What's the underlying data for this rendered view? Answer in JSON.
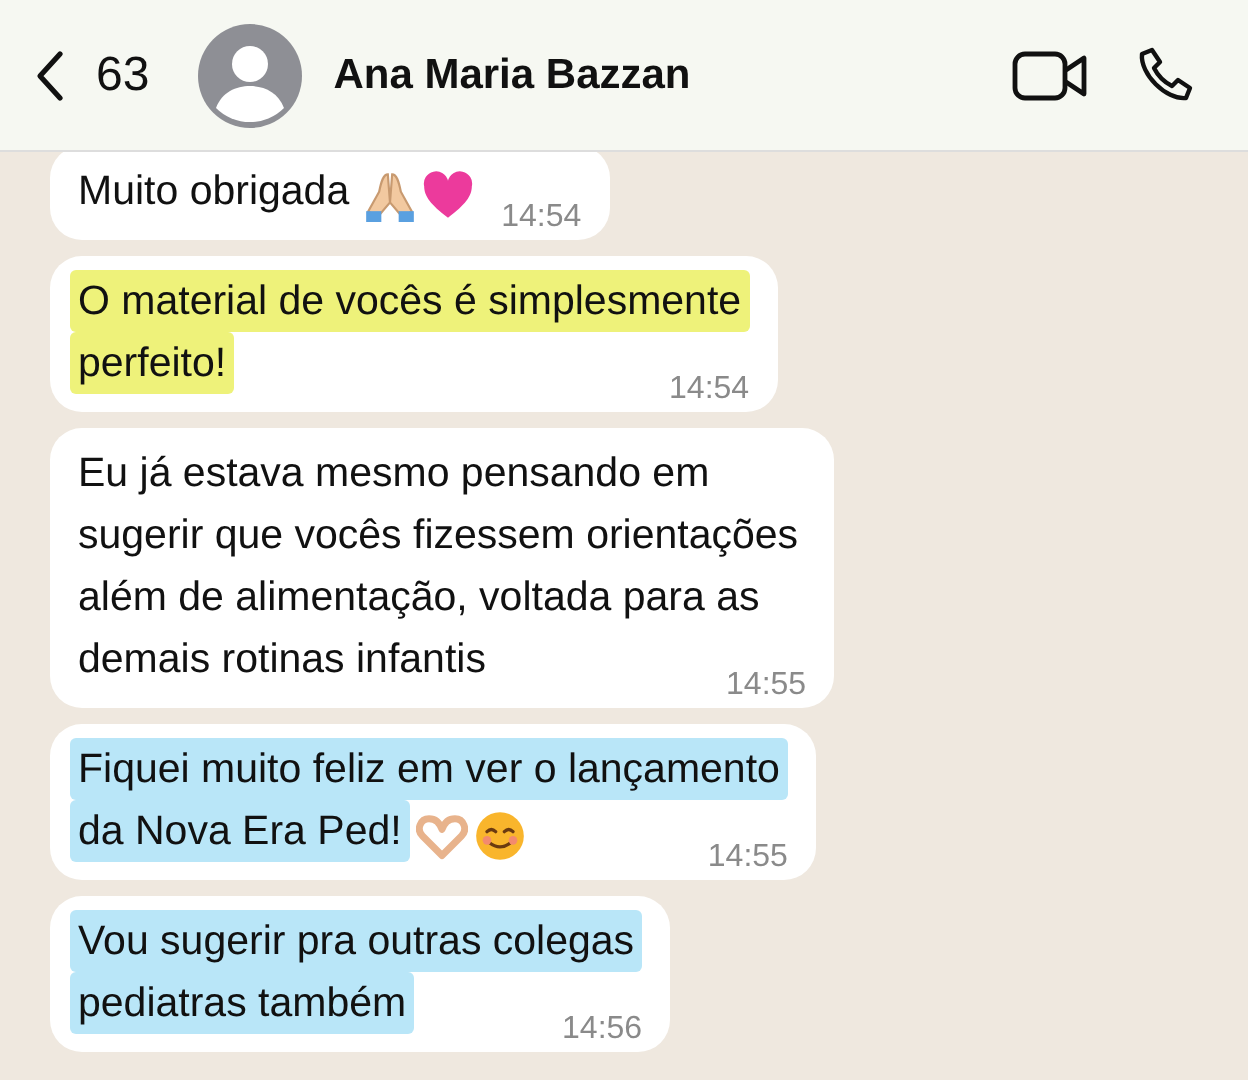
{
  "header": {
    "back_count": "63",
    "contact_name": "Ana Maria Bazzan"
  },
  "messages": [
    {
      "lines": [
        "Muito obrigada"
      ],
      "icons": [
        {
          "kind": "praying-hands"
        },
        {
          "kind": "heart"
        }
      ],
      "time": "14:54"
    },
    {
      "lines": [
        "O material de vocês é simplesmente",
        "perfeito!"
      ],
      "color": "#eef27a",
      "time": "14:54"
    },
    {
      "lines": [
        "Eu já estava mesmo pensando em",
        "sugerir que vocês fizessem orientações",
        "além de alimentação, voltada para as",
        "demais rotinas infantis"
      ],
      "time": "14:55"
    },
    {
      "lines": [
        "Fiquei muito feliz em ver o lançamento",
        "da Nova Era Ped!"
      ],
      "color": "#b9e6f8",
      "icons": [
        {
          "kind": "heart-hands"
        },
        {
          "kind": "smile"
        }
      ],
      "time": "14:55"
    },
    {
      "lines": [
        "Vou sugerir pra outras colegas",
        "pediatras também"
      ],
      "color": "#b9e6f8",
      "time": "14:56"
    }
  ]
}
